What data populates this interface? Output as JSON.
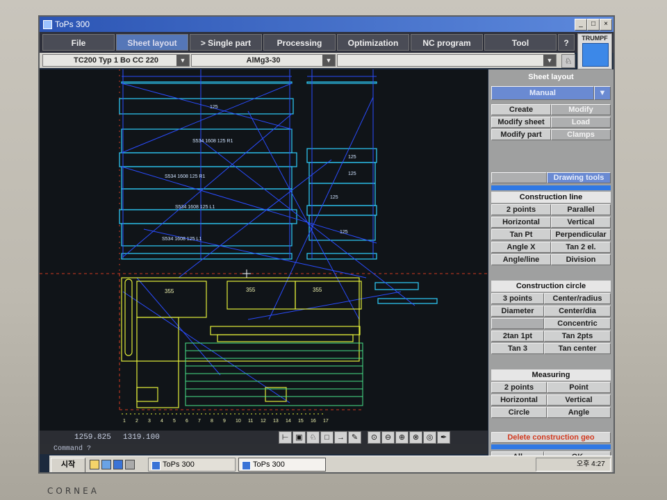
{
  "window": {
    "title": "ToPs 300"
  },
  "menu": [
    "File",
    "Sheet layout",
    "> Single part",
    "Processing",
    "Optimization",
    "NC program",
    "Tool",
    "?"
  ],
  "brand": {
    "trumpf": "TRUMPF",
    "monitor": "CORNEA"
  },
  "selects": {
    "machine": "TC200 Typ 1 Bo CC 220",
    "material": "AlMg3-30",
    "third": ""
  },
  "panel": {
    "title": "Sheet layout",
    "mode": "Manual",
    "top_buttons": [
      "Create",
      "Modify",
      "Modify sheet",
      "Load",
      "Modify part",
      "Clamps"
    ],
    "drawing_tools": "Drawing tools",
    "construction_line": {
      "title": "Construction line",
      "buttons": [
        "2 points",
        "Parallel",
        "Horizontal",
        "Vertical",
        "Tan Pt",
        "Perpendicular",
        "Angle X",
        "Tan 2 el.",
        "Angle/line",
        "Division"
      ]
    },
    "construction_circle": {
      "title": "Construction circle",
      "buttons": [
        "3 points",
        "Center/radius",
        "Diameter",
        "Center/dia",
        "Concentric",
        "2tan 1pt",
        "Tan 2pts",
        "Tan 3",
        "Tan center"
      ]
    },
    "measuring": {
      "title": "Measuring",
      "buttons": [
        "2 points",
        "Point",
        "Horizontal",
        "Vertical",
        "Circle",
        "Angle"
      ]
    },
    "delete": "Delete construction geo",
    "bottom_buttons": [
      "All",
      "OK"
    ]
  },
  "status": {
    "x": "1259.825",
    "y": "1319.100",
    "command": "Command ?"
  },
  "drawing": {
    "part_labels": [
      "125",
      "S534 1608 125 R1",
      "S534 1608 125 R1",
      "S534 1608 125 L1",
      "S534 1608 125 L1",
      "125",
      "125",
      "125",
      "125",
      "355",
      "355",
      "355"
    ],
    "ruler": [
      "1",
      "2",
      "3",
      "4",
      "5",
      "6",
      "7",
      "8",
      "9",
      "10",
      "11",
      "12",
      "13",
      "14",
      "15",
      "16",
      "17"
    ]
  },
  "taskbar": {
    "start": "시작",
    "tasks": [
      "ToPs 300",
      "ToPs 300"
    ],
    "time": "오후 4:27"
  },
  "colors": {
    "accent": "#2f78e4",
    "cyan_part": "#2fd0ff",
    "blue_line": "#2a4cff",
    "yellow_part": "#e4ef3a",
    "red_dash": "#d23a20"
  }
}
